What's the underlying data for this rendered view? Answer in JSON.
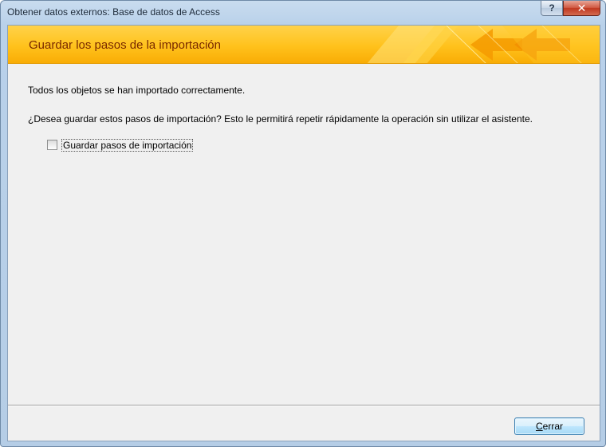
{
  "window": {
    "title": "Obtener datos externos: Base de datos de Access",
    "help_glyph": "?",
    "close_glyph": "✕"
  },
  "banner": {
    "title": "Guardar los pasos de la importación"
  },
  "content": {
    "message_success": "Todos los objetos se han importado correctamente.",
    "message_question": "¿Desea guardar estos pasos de importación? Esto le permitirá repetir rápidamente la operación sin utilizar el asistente.",
    "save_steps_checkbox": {
      "label": "Guardar pasos de importación",
      "checked": false
    }
  },
  "footer": {
    "close_button": {
      "accelerator": "C",
      "label_rest": "errar"
    }
  },
  "colors": {
    "banner_top": "#ffd24a",
    "banner_bottom": "#f9ad05",
    "banner_title": "#7a2a00",
    "window_chrome": "#b9d1ea",
    "close_red": "#c03820"
  }
}
